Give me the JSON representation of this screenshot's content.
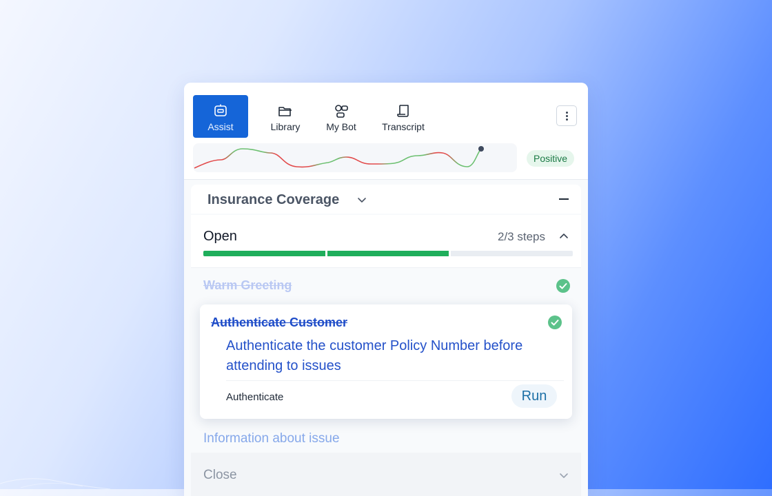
{
  "tabs": [
    {
      "label": "Assist",
      "icon": "assist-bot-icon",
      "active": true
    },
    {
      "label": "Library",
      "icon": "folder-icon",
      "active": false
    },
    {
      "label": "My Bot",
      "icon": "bot-flow-icon",
      "active": false
    },
    {
      "label": "Transcript",
      "icon": "scroll-icon",
      "active": false
    }
  ],
  "sentiment": {
    "label": "Positive"
  },
  "playbook": {
    "title": "Insurance Coverage"
  },
  "stage_open": {
    "name": "Open",
    "count": "2/3 steps",
    "progress_completed": 2,
    "progress_total": 3
  },
  "steps": {
    "warm_greeting": {
      "label": "Warm Greeting"
    },
    "authenticate": {
      "label": "Authenticate Customer",
      "description": "Authenticate the customer Policy Number before attending to issues",
      "action_label": "Authenticate",
      "run_label": "Run"
    },
    "information": {
      "label": "Information about issue"
    }
  },
  "stage_close": {
    "name": "Close"
  },
  "colors": {
    "accent": "#1565d8",
    "success": "#1fae5b",
    "check": "#5cc28a",
    "sentiment_positive": "#6cc070",
    "sentiment_negative": "#e24a4a"
  }
}
